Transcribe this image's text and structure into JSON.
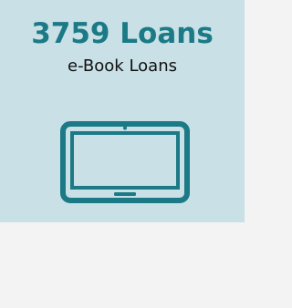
{
  "card": {
    "count_label": "3759 Loans",
    "subtitle": "e-Book Loans",
    "icon": "tablet-icon"
  },
  "colors": {
    "card_background": "#c8e0e6",
    "accent": "#1b7a85",
    "page_background": "#f3f3f3"
  }
}
